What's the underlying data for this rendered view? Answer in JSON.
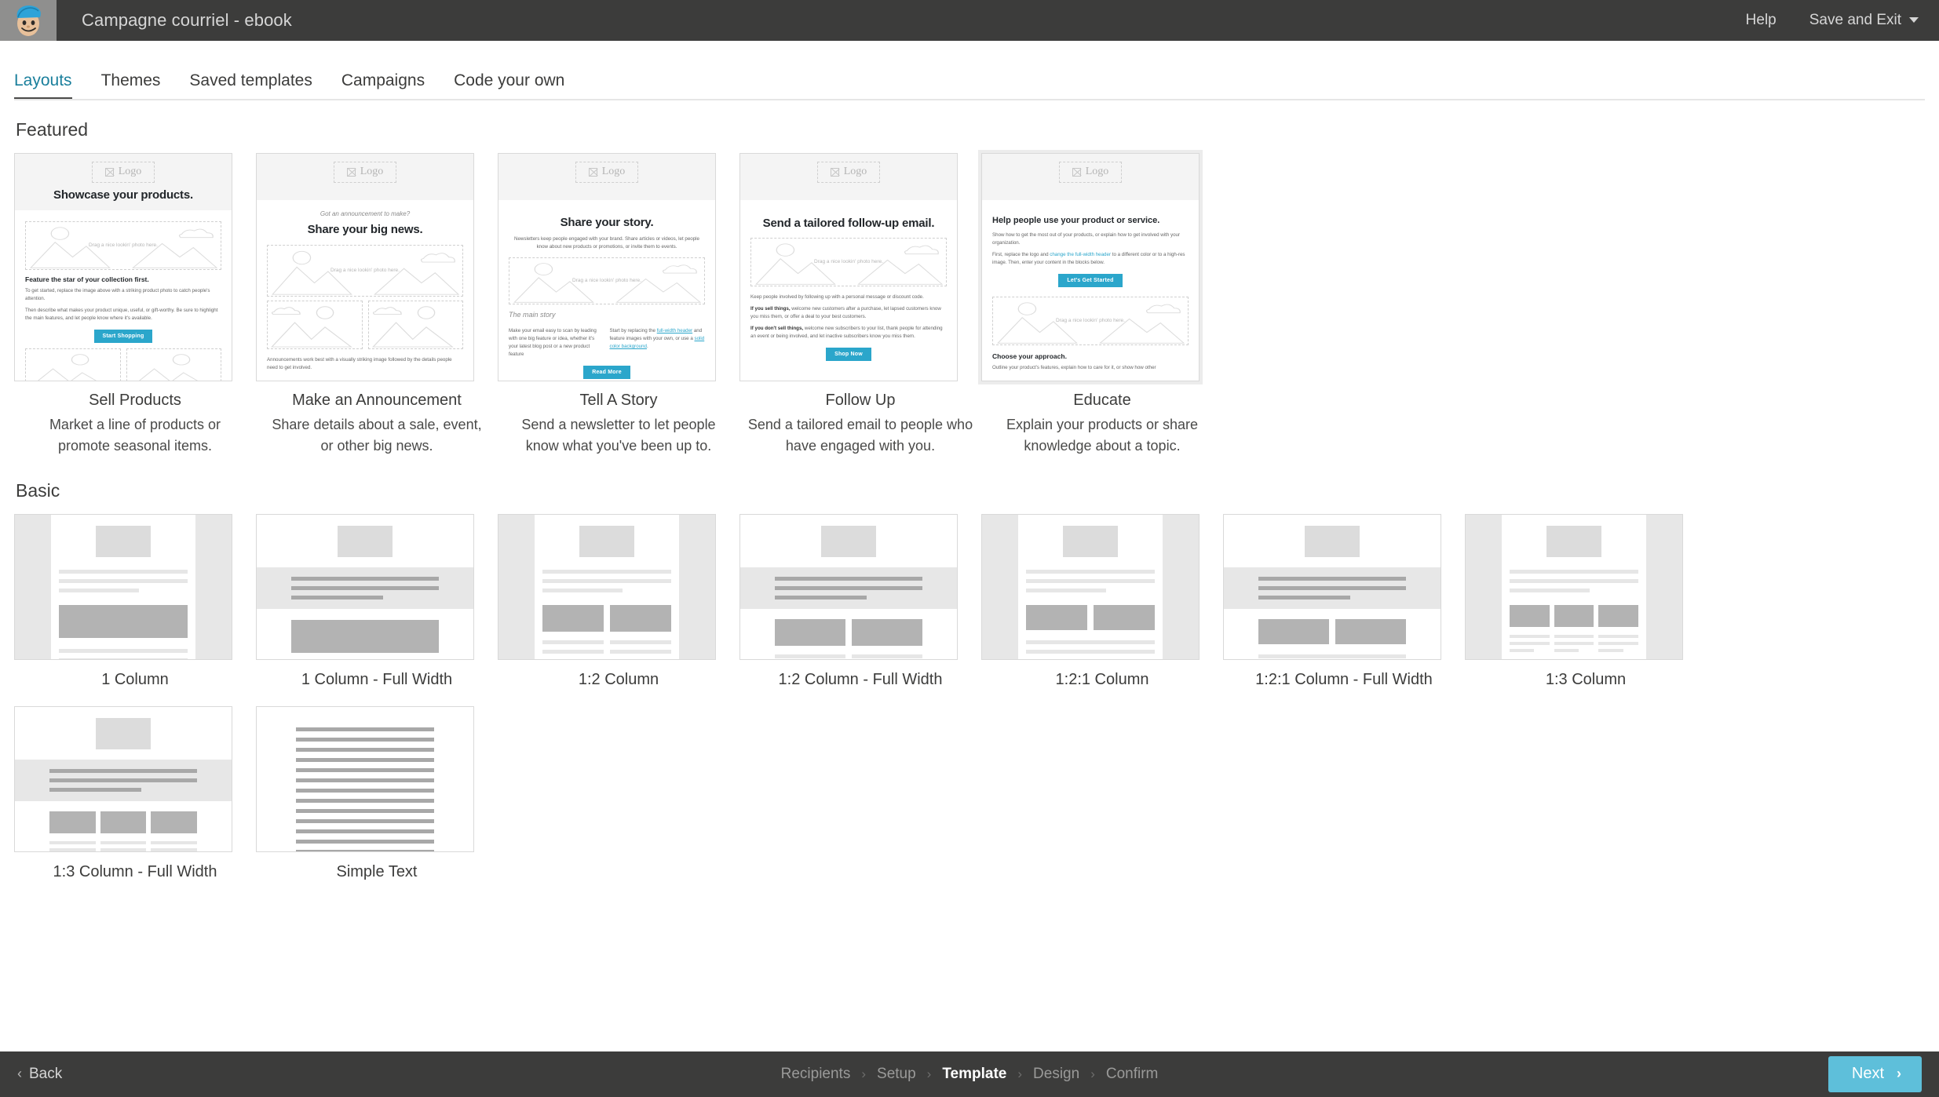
{
  "topbar": {
    "logo_icon": "mailchimp-freddie-icon",
    "campaign_title": "Campagne courriel - ebook",
    "help_label": "Help",
    "save_exit_label": "Save and Exit",
    "caret_icon": "chevron-down-icon",
    "bg_color": "#3c3c3b"
  },
  "tabs": [
    {
      "label": "Layouts",
      "active": true
    },
    {
      "label": "Themes",
      "active": false
    },
    {
      "label": "Saved templates",
      "active": false
    },
    {
      "label": "Campaigns",
      "active": false
    },
    {
      "label": "Code your own",
      "active": false
    }
  ],
  "accent_color": "#1a7f9c",
  "button_color": "#2ba6cb",
  "next_button_color": "#5ebfda",
  "sections": {
    "featured": {
      "title": "Featured",
      "cards": [
        {
          "name": "Sell Products",
          "description": "Market a line of products or promote seasonal items.",
          "preview": {
            "logo_label": "Logo",
            "headline": "Showcase your products.",
            "photo_caption": "Drag a nice lookin' photo here.",
            "subhead": "Feature the star of your collection first.",
            "para1": "To get started, replace the image above with a striking product photo to catch people's attention.",
            "para2": "Then describe what makes your product unique, useful, or gift-worthy. Be sure to highlight the main features, and let people know where it's available.",
            "cta": "Start Shopping"
          }
        },
        {
          "name": "Make an Announcement",
          "description": "Share details about a sale, event, or other big news.",
          "preview": {
            "logo_label": "Logo",
            "eyebrow": "Got an announcement to make?",
            "headline": "Share your big news.",
            "photo_caption": "Drag a nice lookin' photo here.",
            "para1": "Announcements work best with a visually striking image followed by the details people need to get involved."
          }
        },
        {
          "name": "Tell A Story",
          "description": "Send a newsletter to let people know what you've been up to.",
          "preview": {
            "logo_label": "Logo",
            "headline": "Share your story.",
            "intro": "Newsletters keep people engaged with your brand. Share articles or videos, let people know about new products or promotions, or invite them to events.",
            "photo_caption": "Drag a nice lookin' photo here.",
            "subhead": "The main story",
            "col_left": "Make your email easy to scan by leading with one big feature or idea, whether it's your latest blog post or a new product feature",
            "col_right_pre": "Start by replacing the ",
            "col_right_link1": "full-width header",
            "col_right_mid": " and feature images with your own, or use a ",
            "col_right_link2": "solid color background",
            "col_right_post": ".",
            "cta": "Read More"
          }
        },
        {
          "name": "Follow Up",
          "description": "Send a tailored email to people who have engaged with you.",
          "preview": {
            "logo_label": "Logo",
            "headline": "Send a tailored follow-up email.",
            "photo_caption": "Drag a nice lookin' photo here.",
            "para1": "Keep people involved by following up with a personal message or discount code.",
            "para2_bold": "If you sell things,",
            "para2": " welcome new customers after a purchase, let lapsed customers know you miss them, or offer a deal to your best customers.",
            "para3_bold": "If you don't sell things,",
            "para3": " welcome new subscribers to your list, thank people for attending an event or being involved, and let inactive subscribers know you miss them.",
            "cta": "Shop Now"
          }
        },
        {
          "name": "Educate",
          "description": "Explain your products or share knowledge about a topic.",
          "selected": true,
          "preview": {
            "logo_label": "Logo",
            "headline": "Help people use your product or service.",
            "para1": "Show how to get the most out of your products, or explain how to get involved with your organization.",
            "para2_pre": "First, replace the logo and ",
            "para2_link": "change the full-width header",
            "para2_post": " to a different color or to a high-res image. Then, enter your content in the blocks below.",
            "cta": "Let's Get Started",
            "photo_caption": "Drag a nice lookin' photo here.",
            "subhead2": "Choose your approach.",
            "para3": "Outline your product's features, explain how to care for it, or show how other"
          }
        }
      ]
    },
    "basic": {
      "title": "Basic",
      "cards": [
        {
          "name": "1 Column",
          "style": "boxed-one-col"
        },
        {
          "name": "1 Column - Full Width",
          "style": "full-one-col"
        },
        {
          "name": "1:2 Column",
          "style": "boxed-two-col"
        },
        {
          "name": "1:2 Column - Full Width",
          "style": "full-two-col"
        },
        {
          "name": "1:2:1 Column",
          "style": "boxed-two-col-wide"
        },
        {
          "name": "1:2:1 Column - Full Width",
          "style": "full-two-col-wide"
        },
        {
          "name": "1:3 Column",
          "style": "boxed-three-col"
        },
        {
          "name": "1:3 Column - Full Width",
          "style": "full-three-col"
        },
        {
          "name": "Simple Text",
          "style": "simple-text"
        }
      ]
    }
  },
  "footer": {
    "back_label": "Back",
    "back_icon": "chevron-left-icon",
    "breadcrumb": [
      {
        "label": "Recipients",
        "current": false
      },
      {
        "label": "Setup",
        "current": false
      },
      {
        "label": "Template",
        "current": true
      },
      {
        "label": "Design",
        "current": false
      },
      {
        "label": "Confirm",
        "current": false
      }
    ],
    "separator": "›",
    "next_label": "Next",
    "next_icon": "chevron-right-icon"
  }
}
